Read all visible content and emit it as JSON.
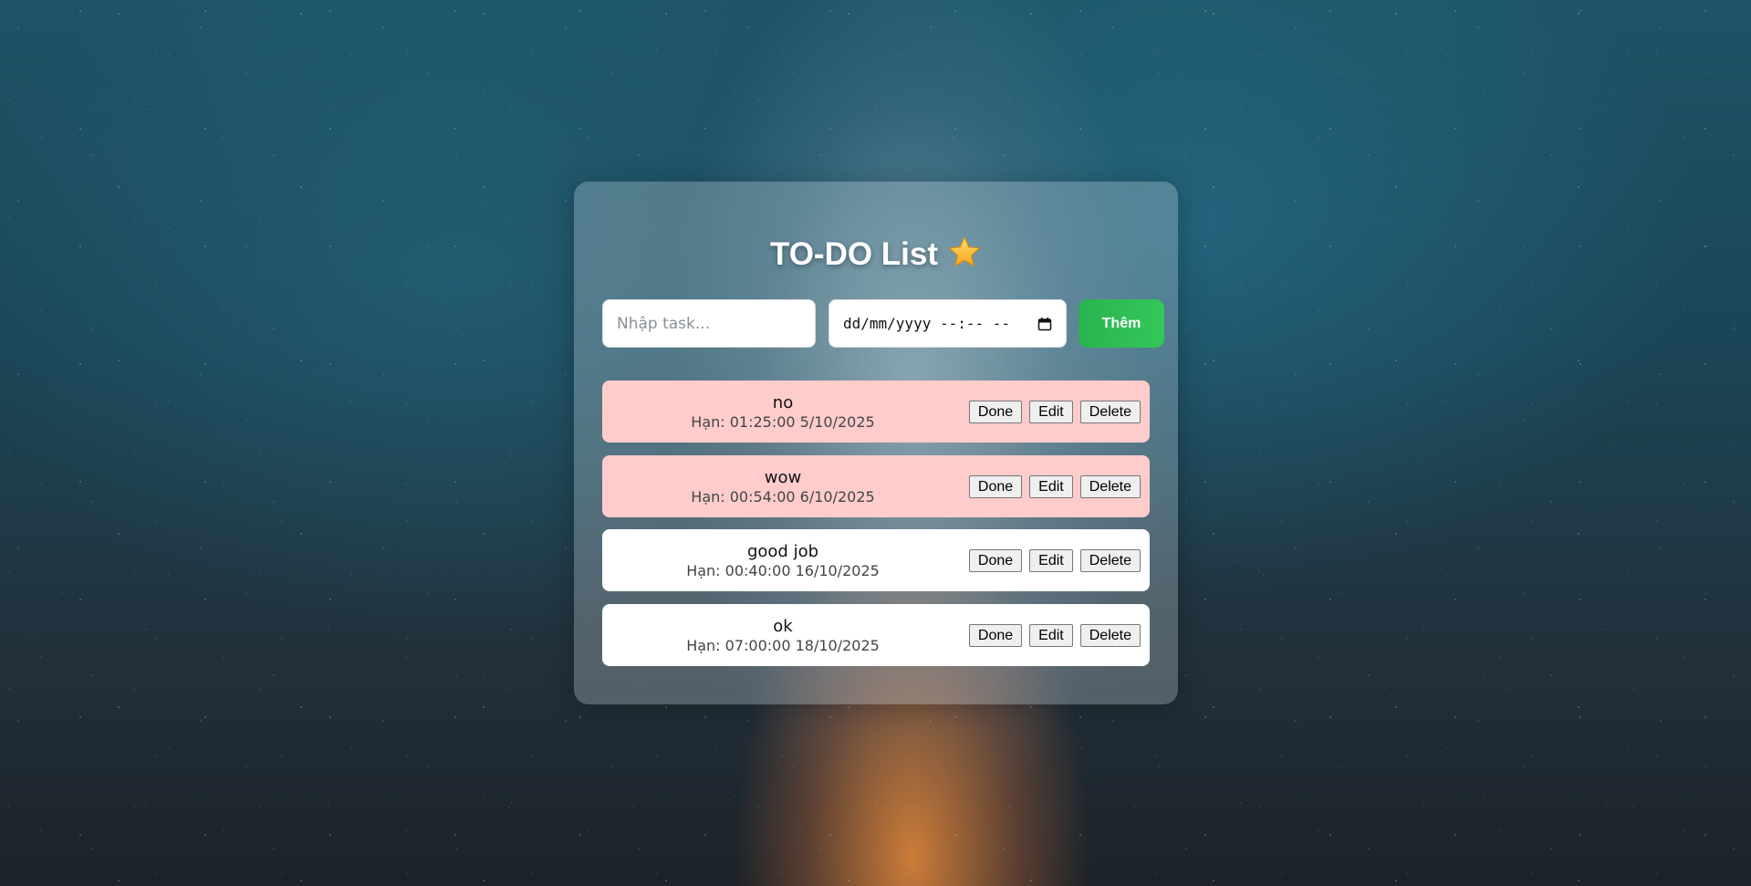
{
  "app": {
    "title": "TO-DO List"
  },
  "form": {
    "task_placeholder": "Nhập task...",
    "task_value": "",
    "date_placeholder": "dd/mm/yyyy --:-- --",
    "add_label": "Thêm"
  },
  "tasks": [
    {
      "name": "no",
      "due": "Hạn: 01:25:00 5/10/2025",
      "status": "overdue"
    },
    {
      "name": "wow",
      "due": "Hạn: 00:54:00 6/10/2025",
      "status": "overdue"
    },
    {
      "name": "good job",
      "due": "Hạn: 00:40:00 16/10/2025",
      "status": "normal"
    },
    {
      "name": "ok",
      "due": "Hạn: 07:00:00 18/10/2025",
      "status": "normal"
    }
  ],
  "actions": {
    "done_label": "Done",
    "edit_label": "Edit",
    "delete_label": "Delete"
  },
  "colors": {
    "overdue_bg": "#ffcccc",
    "normal_bg": "#ffffff",
    "add_button": "#34c759"
  },
  "icons": {
    "title_icon": "star-icon",
    "date_icon": "calendar-icon"
  }
}
